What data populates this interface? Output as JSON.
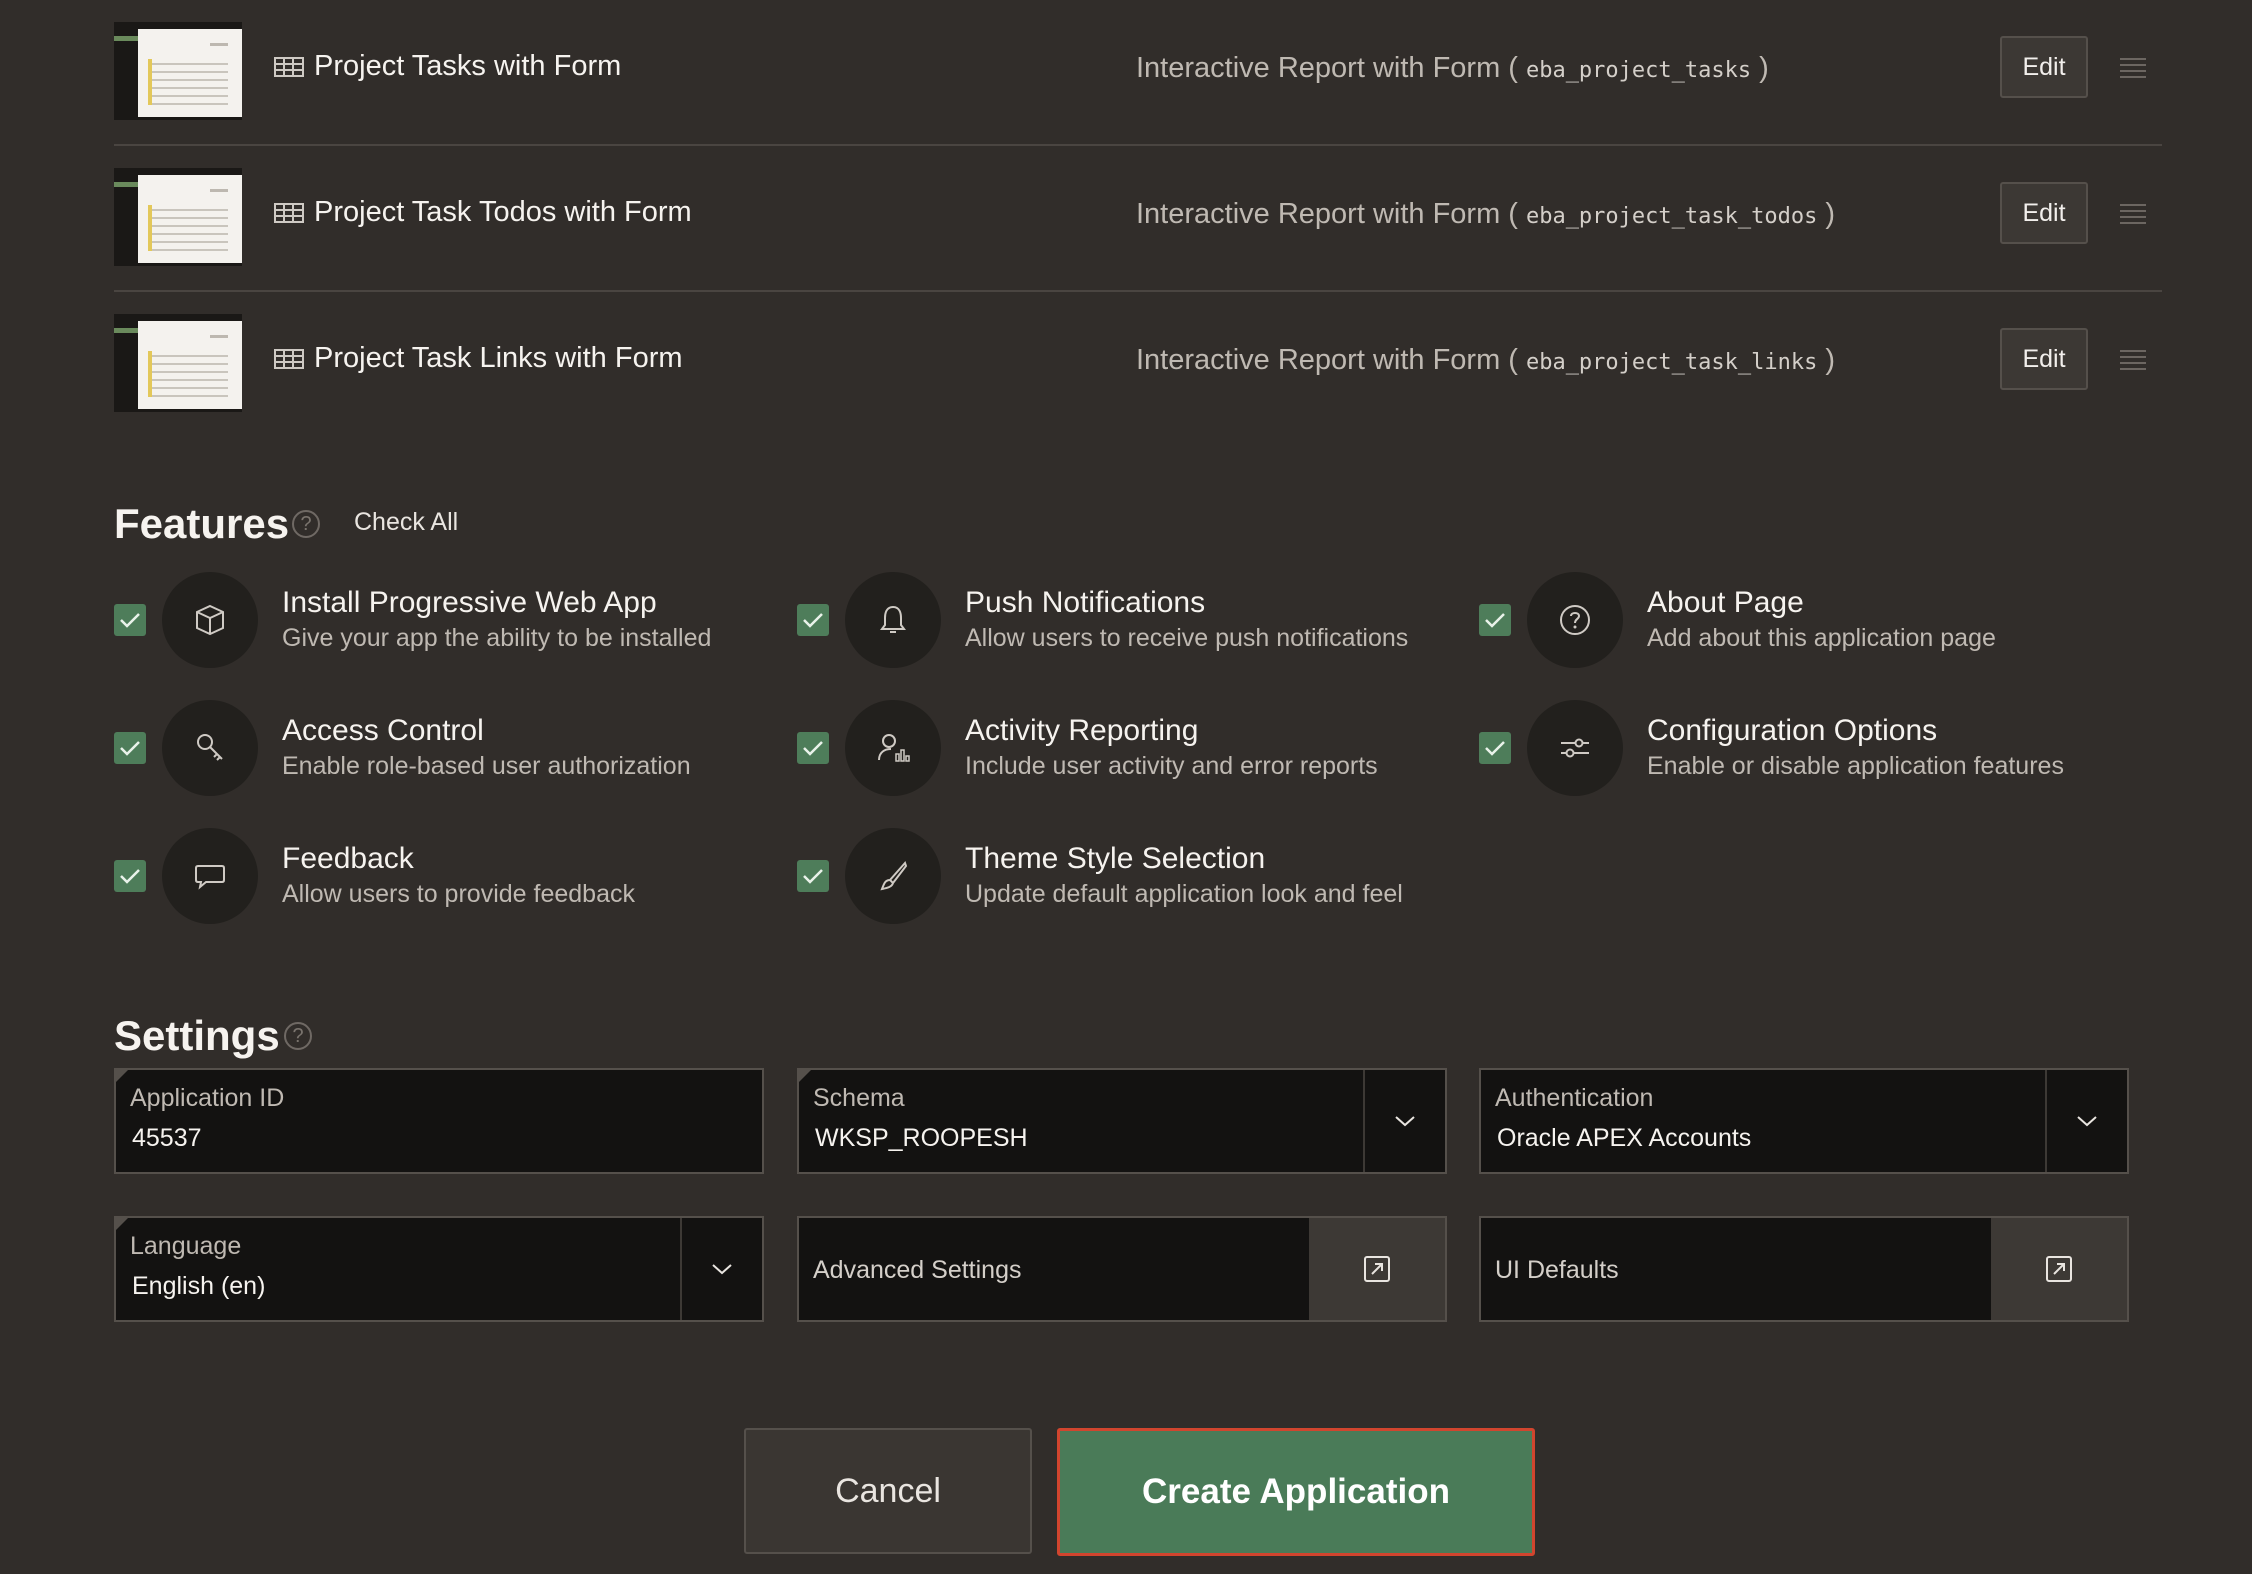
{
  "pages": [
    {
      "name": "Project Tasks with Form",
      "type": "Interactive Report with Form (",
      "table": "eba_project_tasks",
      "close": ")",
      "edit": "Edit"
    },
    {
      "name": "Project Task Todos with Form",
      "type": "Interactive Report with Form (",
      "table": "eba_project_task_todos",
      "close": ")",
      "edit": "Edit"
    },
    {
      "name": "Project Task Links with Form",
      "type": "Interactive Report with Form (",
      "table": "eba_project_task_links",
      "close": ")",
      "edit": "Edit"
    }
  ],
  "features": {
    "title": "Features",
    "check_all": "Check All",
    "items": [
      {
        "title": "Install Progressive Web App",
        "desc": "Give your app the ability to be installed",
        "icon": "cube-icon",
        "checked": true
      },
      {
        "title": "Push Notifications",
        "desc": "Allow users to receive push notifications",
        "icon": "bell-icon",
        "checked": true
      },
      {
        "title": "About Page",
        "desc": "Add about this application page",
        "icon": "question-circle-icon",
        "checked": true
      },
      {
        "title": "Access Control",
        "desc": "Enable role-based user authorization",
        "icon": "key-icon",
        "checked": true
      },
      {
        "title": "Activity Reporting",
        "desc": "Include user activity and error reports",
        "icon": "user-chart-icon",
        "checked": true
      },
      {
        "title": "Configuration Options",
        "desc": "Enable or disable application features",
        "icon": "sliders-icon",
        "checked": true
      },
      {
        "title": "Feedback",
        "desc": "Allow users to provide feedback",
        "icon": "speech-bubble-icon",
        "checked": true
      },
      {
        "title": "Theme Style Selection",
        "desc": "Update default application look and feel",
        "icon": "brush-icon",
        "checked": true
      }
    ]
  },
  "settings": {
    "title": "Settings",
    "application_id": {
      "label": "Application ID",
      "value": "45537"
    },
    "schema": {
      "label": "Schema",
      "value": "WKSP_ROOPESH"
    },
    "authentication": {
      "label": "Authentication",
      "value": "Oracle APEX Accounts"
    },
    "language": {
      "label": "Language",
      "value": "English (en)"
    },
    "advanced": {
      "label": "Advanced Settings"
    },
    "ui_defaults": {
      "label": "UI Defaults"
    }
  },
  "actions": {
    "cancel": "Cancel",
    "create": "Create Application"
  },
  "colors": {
    "background": "#312d2a",
    "checkbox": "#4e7d5a",
    "primary_button": "#4a7b58",
    "focus_ring": "#d1452e"
  }
}
